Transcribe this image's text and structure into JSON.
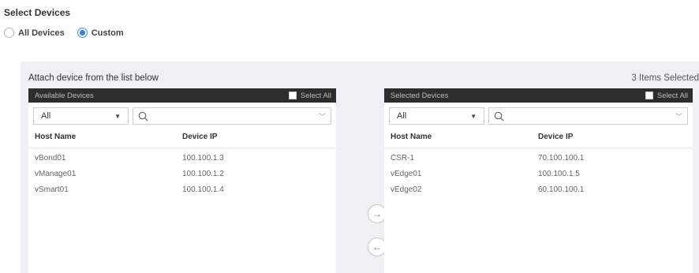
{
  "section_title": "Select Devices",
  "device_scope": {
    "options": [
      {
        "label": "All Devices",
        "checked": false
      },
      {
        "label": "Custom",
        "checked": true
      }
    ]
  },
  "attach_title": "Attach device from the list below",
  "items_selected": "3 Items Selected",
  "available": {
    "header": "Available Devices",
    "select_all": "Select All",
    "filter_value": "All",
    "columns": [
      "Host Name",
      "Device IP"
    ],
    "rows": [
      {
        "host": "vBond01",
        "ip": "100.100.1.3"
      },
      {
        "host": "vManage01",
        "ip": "100.100.1.2"
      },
      {
        "host": "vSmart01",
        "ip": "100.100.1.4"
      }
    ]
  },
  "selected": {
    "header": "Selected Devices",
    "select_all": "Select All",
    "filter_value": "All",
    "columns": [
      "Host Name",
      "Device IP"
    ],
    "rows": [
      {
        "host": "CSR-1",
        "ip": "70.100.100.1"
      },
      {
        "host": "vEdge01",
        "ip": "100.100.1.5"
      },
      {
        "host": "vEdge02",
        "ip": "60.100.100.1"
      }
    ]
  },
  "transfer": {
    "add_icon": "arrow-right-icon",
    "remove_icon": "arrow-left-icon"
  },
  "colors": {
    "accent": "#2f86d4",
    "header_bg": "#2d2d2d",
    "panel_bg": "#eef0f3"
  }
}
